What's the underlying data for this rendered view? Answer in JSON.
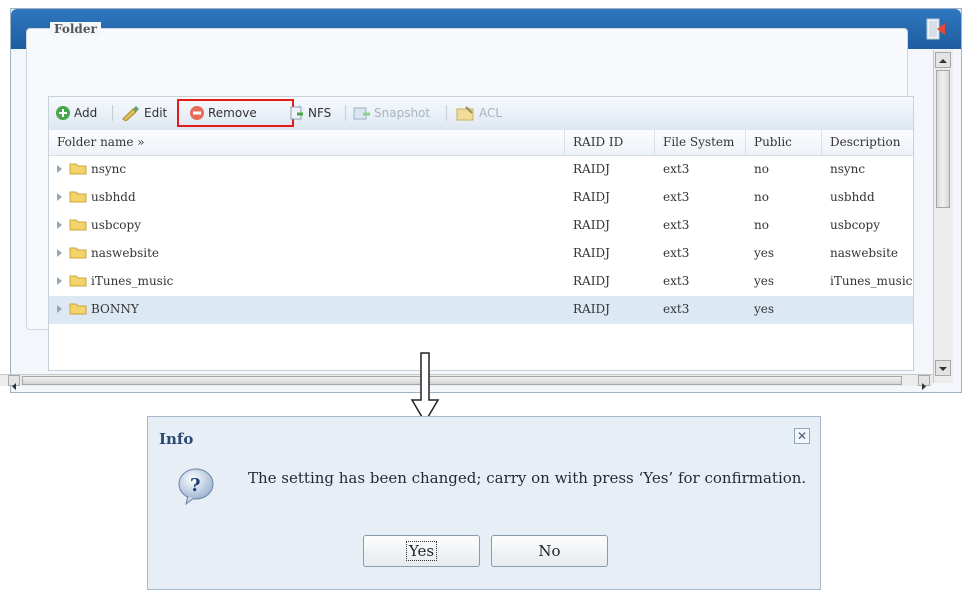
{
  "fieldset": {
    "legend": "Folder"
  },
  "toolbar": {
    "add": "Add",
    "edit": "Edit",
    "remove": "Remove",
    "nfs": "NFS",
    "snapshot": "Snapshot",
    "acl": "ACL"
  },
  "table": {
    "columns": [
      "Folder name »",
      "RAID ID",
      "File System",
      "Public",
      "Description"
    ],
    "rows": [
      {
        "name": "nsync",
        "raid": "RAIDJ",
        "fs": "ext3",
        "public": "no",
        "desc": "nsync"
      },
      {
        "name": "usbhdd",
        "raid": "RAIDJ",
        "fs": "ext3",
        "public": "no",
        "desc": "usbhdd"
      },
      {
        "name": "usbcopy",
        "raid": "RAIDJ",
        "fs": "ext3",
        "public": "no",
        "desc": "usbcopy"
      },
      {
        "name": "naswebsite",
        "raid": "RAIDJ",
        "fs": "ext3",
        "public": "yes",
        "desc": "naswebsite"
      },
      {
        "name": "iTunes_music",
        "raid": "RAIDJ",
        "fs": "ext3",
        "public": "yes",
        "desc": "iTunes_music"
      },
      {
        "name": "BONNY",
        "raid": "RAIDJ",
        "fs": "ext3",
        "public": "yes",
        "desc": ""
      }
    ]
  },
  "dialog": {
    "title": "Info",
    "message": "The setting has been changed; carry on with press ‘Yes’ for confirmation.",
    "yes": "Yes",
    "no": "No"
  },
  "colors": {
    "titlebar": "#2f77bf",
    "highlight": "#e21b1b",
    "selected_row": "#dde8f5"
  }
}
